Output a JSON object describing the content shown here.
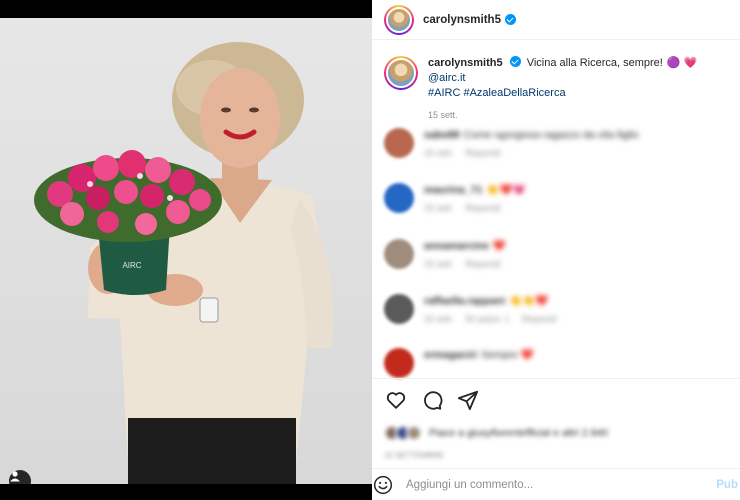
{
  "post": {
    "username": "carolynsmith5",
    "caption_text": "Vicina alla Ricerca, sempre!",
    "caption_emojis": "🟣 💗",
    "mention": "@airc.it",
    "hashtags": "#AIRC #AzaleaDellaRicerca",
    "time": "15 sett.",
    "image_product_label": "AIRC"
  },
  "comments": [
    {
      "user": "sabe88",
      "text": "Come sgorgiosa ragazzo da vita figlio",
      "time": "15 sett.",
      "reply": "Rispondi",
      "likes": "",
      "avatar": "#b9674f"
    },
    {
      "user": "maurina_71",
      "text": "👏❤️💗",
      "time": "15 sett.",
      "reply": "Rispondi",
      "likes": "",
      "avatar": "#2567c4"
    },
    {
      "user": "annamarcine",
      "text": "❤️",
      "time": "15 sett.",
      "reply": "Rispondi",
      "likes": "",
      "avatar": "#9e8c7c"
    },
    {
      "user": "raffaella.rappani",
      "text": "👏👏❤️",
      "time": "15 sett.",
      "reply": "Rispondi",
      "likes": "50 piace: 1",
      "avatar": "#5a5a5a"
    },
    {
      "user": "ermagaciri",
      "text": "Sempre ❤️",
      "time": "",
      "reply": "",
      "likes": "",
      "avatar": "#c22a1c"
    }
  ],
  "likes_text": "Piace a giusyfiorentefficial e altri 2.940",
  "post_date": "15 SETTEMBRE",
  "composer": {
    "placeholder": "Aggiungi un commento...",
    "publish_label": "Pub"
  },
  "icons": {
    "like": "heart-icon",
    "comment": "comment-icon",
    "share": "share-icon",
    "emoji": "emoji-icon",
    "tag": "user-tag-icon",
    "verified": "verified-badge-icon"
  },
  "colors": {
    "accent": "#0095f6",
    "link": "#00376b",
    "muted": "#8e8e8e"
  }
}
